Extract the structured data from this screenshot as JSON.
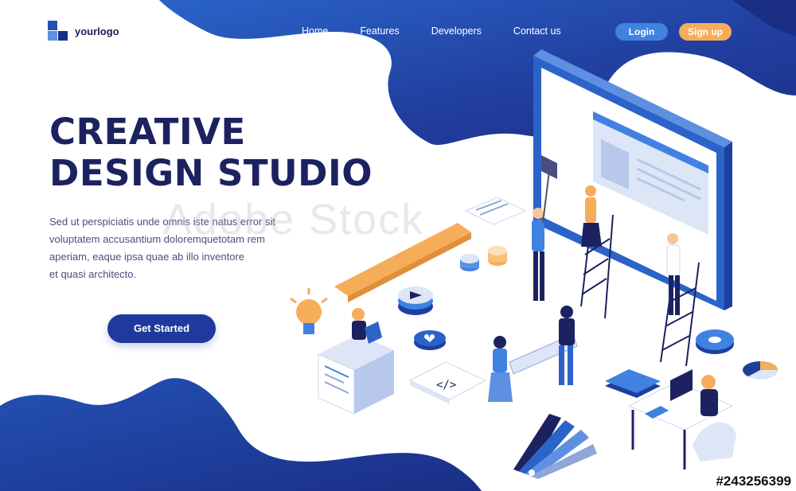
{
  "brand": {
    "logo_text": "yourlogo"
  },
  "nav": {
    "items": [
      "Home",
      "Features",
      "Developers",
      "Contact us"
    ]
  },
  "auth": {
    "login_label": "Login",
    "signup_label": "Sign up"
  },
  "hero": {
    "title_line1": "CREATIVE",
    "title_line2": "DESIGN STUDIO",
    "description_lines": [
      "Sed ut perspiciatis unde omnis iste natus error sit",
      "voluptatem accusantium doloremquetotam rem",
      "aperiam, eaque ipsa quae ab illo inventore",
      "et quasi architecto."
    ],
    "cta_label": "Get Started"
  },
  "illustration": {
    "code_tag": "</>"
  },
  "watermark": {
    "text": "Adobe Stock"
  },
  "stock_id": "#243256399",
  "colors": {
    "navy": "#1c2260",
    "blue": "#1f3a9c",
    "light_blue": "#3f82e1",
    "orange": "#f6ad5a"
  }
}
